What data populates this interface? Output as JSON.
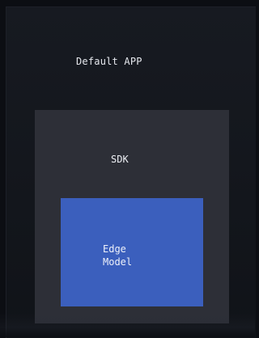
{
  "diagram": {
    "app_label": "Default APP",
    "sdk_label": "SDK",
    "edge_label": "Edge Model"
  },
  "colors": {
    "background": "#0c0e13",
    "app_panel": "#171a21",
    "sdk_panel": "#2d2f37",
    "edge_panel": "#3b5fbd",
    "text": "#e6e8ee"
  }
}
